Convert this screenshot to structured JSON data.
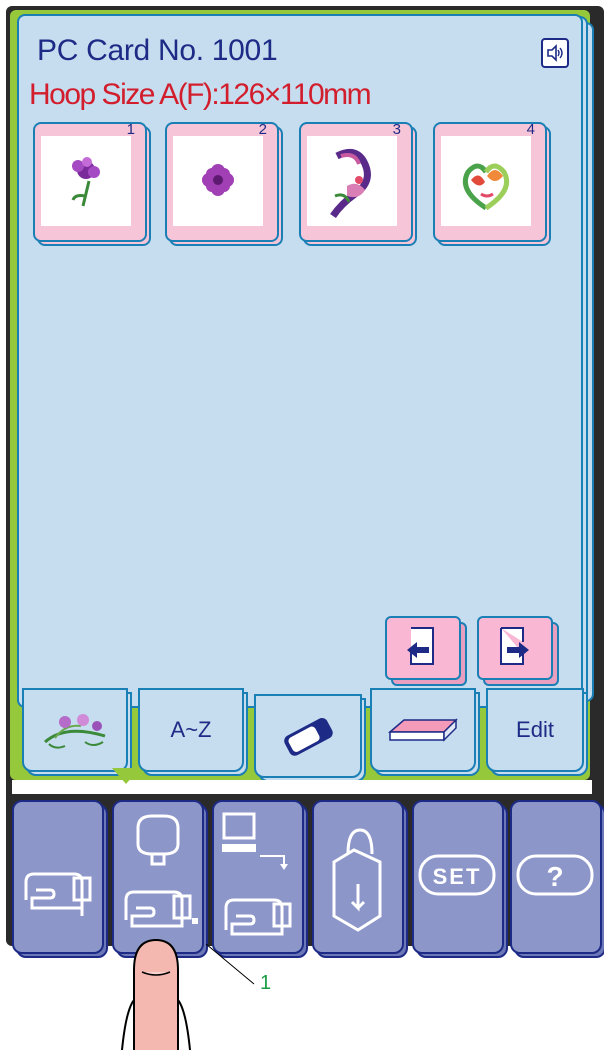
{
  "screen": {
    "title": "PC Card No. 1001",
    "hoop_size": "Hoop Size A(F):126×110mm",
    "speaker_icon": "speaker-icon"
  },
  "designs": [
    {
      "number": "1",
      "icon": "carnation-flower-icon"
    },
    {
      "number": "2",
      "icon": "round-flower-icon"
    },
    {
      "number": "3",
      "icon": "paisley-flower-icon"
    },
    {
      "number": "4",
      "icon": "heart-tulip-icon"
    }
  ],
  "page_nav": {
    "prev_icon": "arrow-left-icon",
    "next_icon": "arrow-right-icon"
  },
  "tabs": [
    {
      "label": "",
      "icon": "floral-design-icon"
    },
    {
      "label": "A~Z",
      "icon": ""
    },
    {
      "label": "",
      "icon": "pc-card-icon",
      "selected": true
    },
    {
      "label": "",
      "icon": "memory-card-icon"
    },
    {
      "label": "Edit",
      "icon": ""
    }
  ],
  "mode_keys": [
    {
      "icon": "ordinary-sewing-icon"
    },
    {
      "icon": "embroidery-mode-icon",
      "pressed": true
    },
    {
      "icon": "pc-link-icon"
    },
    {
      "icon": "bag-icon"
    },
    {
      "icon": "set-icon",
      "text": "SET"
    },
    {
      "icon": "help-icon",
      "text": "?"
    }
  ],
  "colors": {
    "screen_bg": "#c6dcef",
    "frame_green": "#96c83c",
    "title_blue": "#1d2b86",
    "hoop_red": "#d21e2c",
    "tile_pink": "#f7c5d8",
    "key_blue": "#8c96c9"
  },
  "callout": {
    "label": "1"
  }
}
